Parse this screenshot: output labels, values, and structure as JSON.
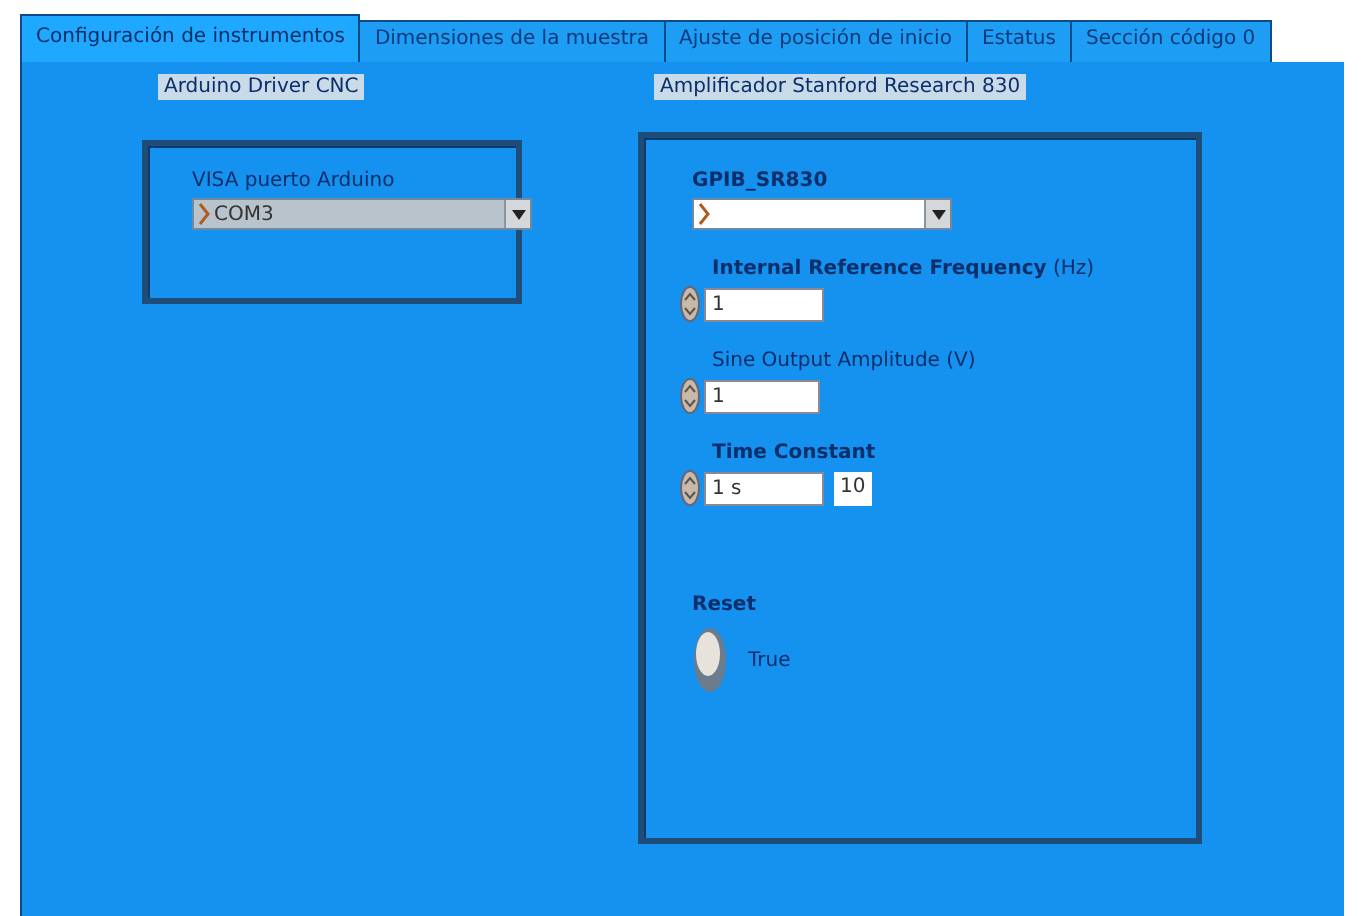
{
  "tabs": [
    {
      "label": "Configuración de instrumentos",
      "selected": true
    },
    {
      "label": "Dimensiones de la muestra",
      "selected": false
    },
    {
      "label": "Ajuste de posición de inicio",
      "selected": false
    },
    {
      "label": "Estatus",
      "selected": false
    },
    {
      "label": "Sección código 0",
      "selected": false
    }
  ],
  "groups": [
    {
      "label": "Arduino Driver CNC",
      "controls": [
        {
          "kind": "visa",
          "label": "VISA puerto Arduino",
          "bold": false,
          "value": "COM3"
        }
      ]
    },
    {
      "label": "Amplificador Stanford Research 830",
      "controls": [
        {
          "kind": "visa",
          "label": "GPIB_SR830",
          "bold": true
        },
        {
          "kind": "numeric",
          "label": "**Internal Reference Frequency** (Hz)",
          "bold": false,
          "value": "1"
        },
        {
          "kind": "numeric",
          "label": "Sine Output Amplitude (V)",
          "bold": false,
          "value": "1"
        },
        {
          "kind": "ring",
          "label": "Time Constant",
          "bold": true,
          "value": "1 s",
          "index": "10"
        },
        {
          "kind": "toggle",
          "label": "Reset",
          "bold": true,
          "on": true,
          "text": "True"
        }
      ]
    }
  ]
}
